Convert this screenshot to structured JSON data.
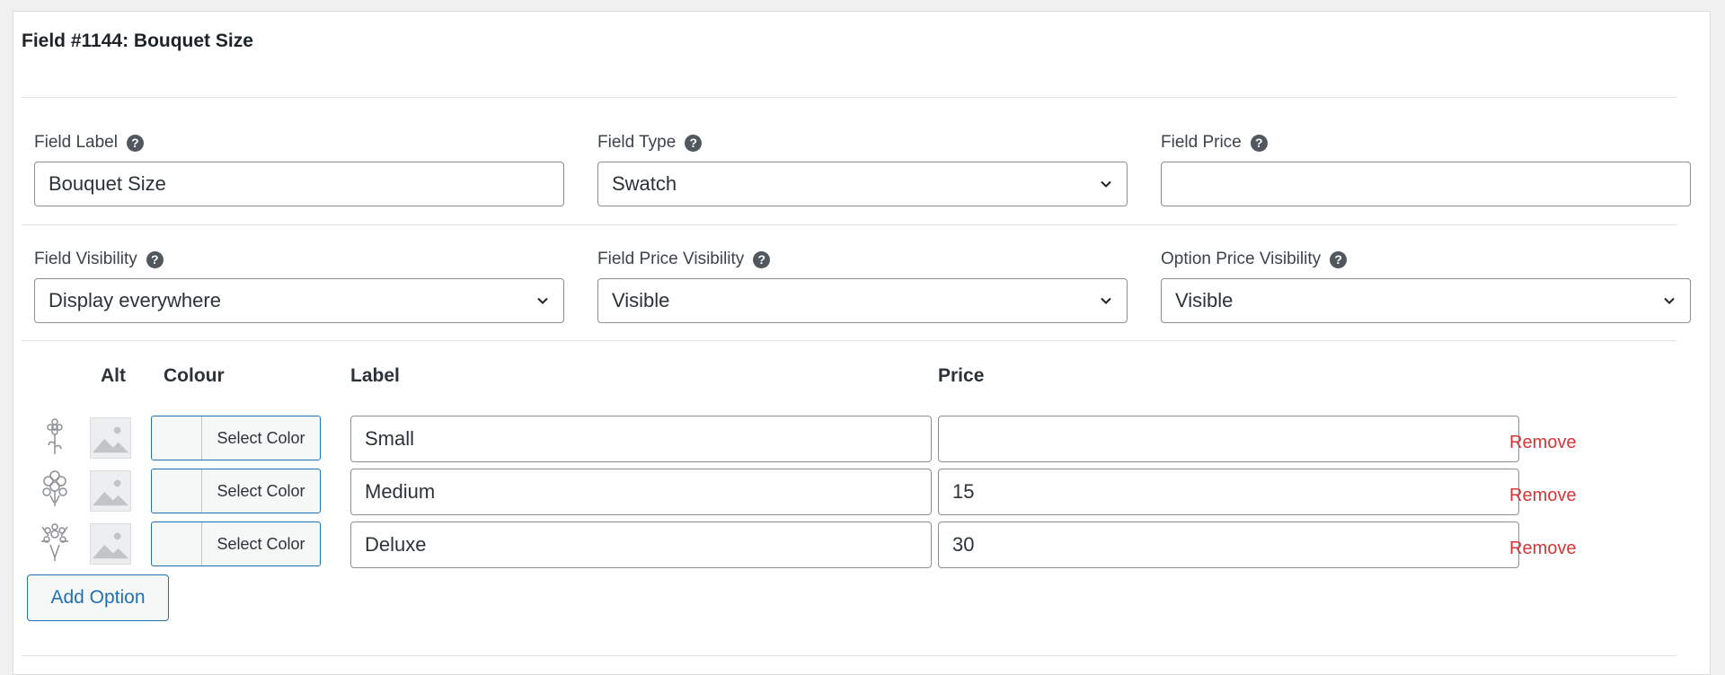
{
  "field": {
    "title": "Field #1144: Bouquet Size"
  },
  "row1": {
    "label_label": "Field Label",
    "label_value": "Bouquet Size",
    "type_label": "Field Type",
    "type_value": "Swatch",
    "price_label": "Field Price",
    "price_value": ""
  },
  "row2": {
    "visibility_label": "Field Visibility",
    "visibility_value": "Display everywhere",
    "price_visibility_label": "Field Price Visibility",
    "price_visibility_value": "Visible",
    "option_price_visibility_label": "Option Price Visibility",
    "option_price_visibility_value": "Visible"
  },
  "help_glyph": "?",
  "options_table": {
    "headers": {
      "alt": "Alt",
      "colour": "Colour",
      "label": "Label",
      "price": "Price"
    },
    "select_color_label": "Select Color",
    "remove_label": "Remove",
    "rows": [
      {
        "icon": "flower-single-icon",
        "label": "Small",
        "price": ""
      },
      {
        "icon": "flower-bunch-icon",
        "label": "Medium",
        "price": "15"
      },
      {
        "icon": "flower-bouquet-icon",
        "label": "Deluxe",
        "price": "30"
      }
    ]
  },
  "add_option_label": "Add Option",
  "colors": {
    "accent": "#2271b1",
    "remove": "#d63638",
    "border": "#8c8f94"
  }
}
